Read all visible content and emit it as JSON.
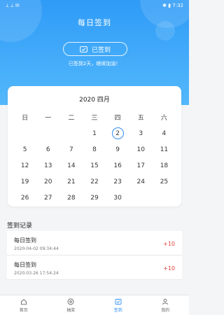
{
  "status": {
    "left": "⟂ ⟂ ✉",
    "right": "✱ ▮ 7:32"
  },
  "header": {
    "title": "每日签到"
  },
  "sign_status": {
    "label": "已签到",
    "streak_text": "已签到2天，继续加油！"
  },
  "calendar": {
    "month_label": "2020 四月",
    "weekdays": [
      "日",
      "一",
      "二",
      "三",
      "四",
      "五",
      "六"
    ],
    "days": [
      "",
      "",
      "",
      "1",
      "2",
      "3",
      "4",
      "5",
      "6",
      "7",
      "8",
      "9",
      "10",
      "11",
      "12",
      "13",
      "14",
      "15",
      "16",
      "17",
      "18",
      "19",
      "20",
      "21",
      "22",
      "23",
      "24",
      "25",
      "26",
      "27",
      "28",
      "29",
      "30",
      "",
      ""
    ],
    "today": "2"
  },
  "records": {
    "title": "签到记录",
    "items": [
      {
        "name": "每日签到",
        "time": "2020-04-02 09:34:44",
        "points": "+10"
      },
      {
        "name": "每日签到",
        "time": "2020-03-26 17:54:24",
        "points": "+10"
      }
    ]
  },
  "tabbar": {
    "items": [
      {
        "label": "首页",
        "icon": "home-icon"
      },
      {
        "label": "抽奖",
        "icon": "lottery-icon"
      },
      {
        "label": "签到",
        "icon": "checkin-icon"
      },
      {
        "label": "我的",
        "icon": "profile-icon"
      }
    ]
  },
  "colors": {
    "accent": "#2f8ef5",
    "hero_top": "#2f9bf7",
    "points": "#e0413a"
  }
}
